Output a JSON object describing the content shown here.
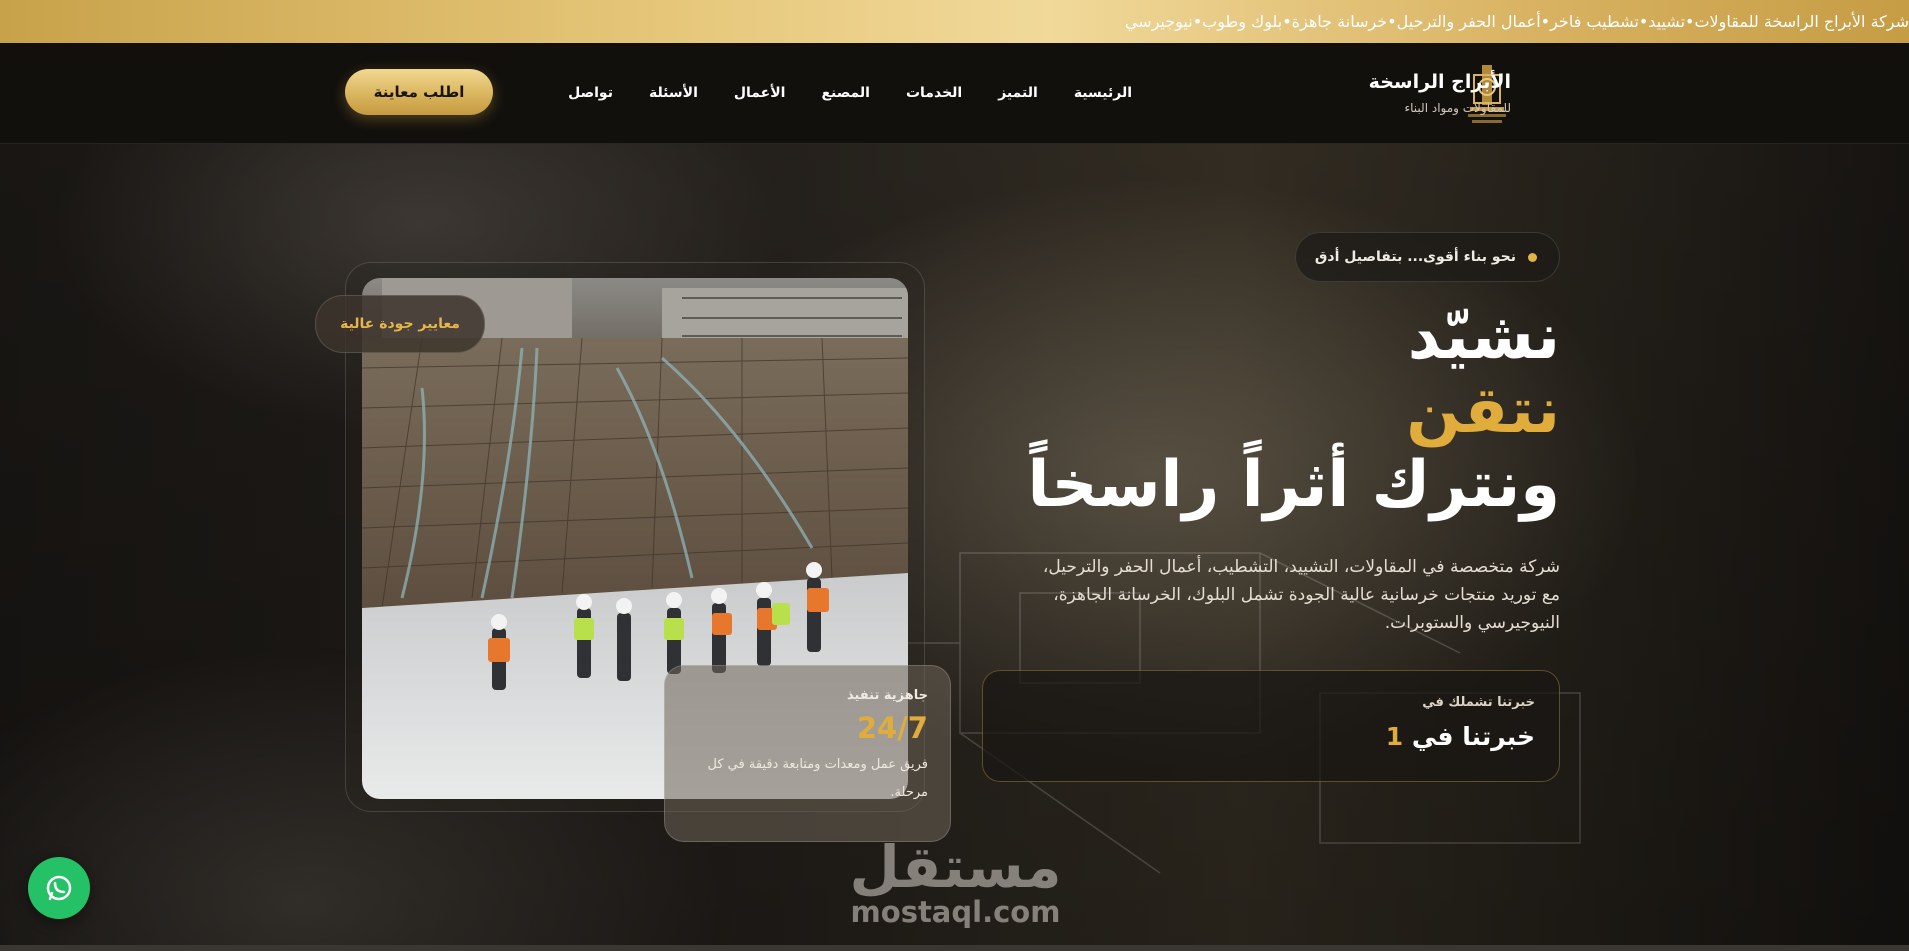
{
  "ticker": {
    "items": [
      "شركة الأبراج الراسخة للمقاولات",
      "تشييد",
      "تشطيب فاخر",
      "أعمال الحفر والترحيل",
      "خرسانة جاهزة",
      "بلوك وطوب",
      "نيوجيرسي"
    ],
    "separator": "•"
  },
  "header": {
    "brand_name": "الأبراج الراسخة",
    "brand_subtitle": "للمقاولات ومواد البناء",
    "logo_icon": "tower-crest-icon",
    "nav": [
      "الرئيسية",
      "التميز",
      "الخدمات",
      "المصنع",
      "الأعمال",
      "الأسئلة",
      "تواصل"
    ],
    "cta_label": "اطلب معاينة"
  },
  "hero": {
    "badge": "نحو بناء أقوى... بتفاصيل أدق",
    "headline": [
      "نشيّد",
      "نتقن",
      "ونترك أثراً راسخاً"
    ],
    "description": "شركة متخصصة في المقاولات، التشييد، التشطيب، أعمال الحفر والترحيل، مع توريد منتجات خرسانية عالية الجودة تشمل البلوك، الخرسانة الجاهزة، النيوجيرسي والستوبرات.",
    "experience": {
      "label": "خبرتنا تشملك في",
      "value_prefix": "خبرتنا في",
      "value_number": "1"
    },
    "quality_chip": "معايير جودة عالية",
    "ready_card": {
      "label": "جاهزية تنفيذ",
      "value": "24/7",
      "text": "فريق عمل ومعدات ومتابعة دقيقة في كل مرحلة."
    },
    "photo_alt": "construction-site-photo"
  },
  "watermark": {
    "arabic": "مستقل",
    "latin": "mostaql.com"
  },
  "whatsapp": {
    "icon": "whatsapp-icon"
  },
  "colors": {
    "gold": "#e0ac3c",
    "ticker_gold": "#e6c77a",
    "whatsapp": "#25c167",
    "dark": "#141210"
  }
}
